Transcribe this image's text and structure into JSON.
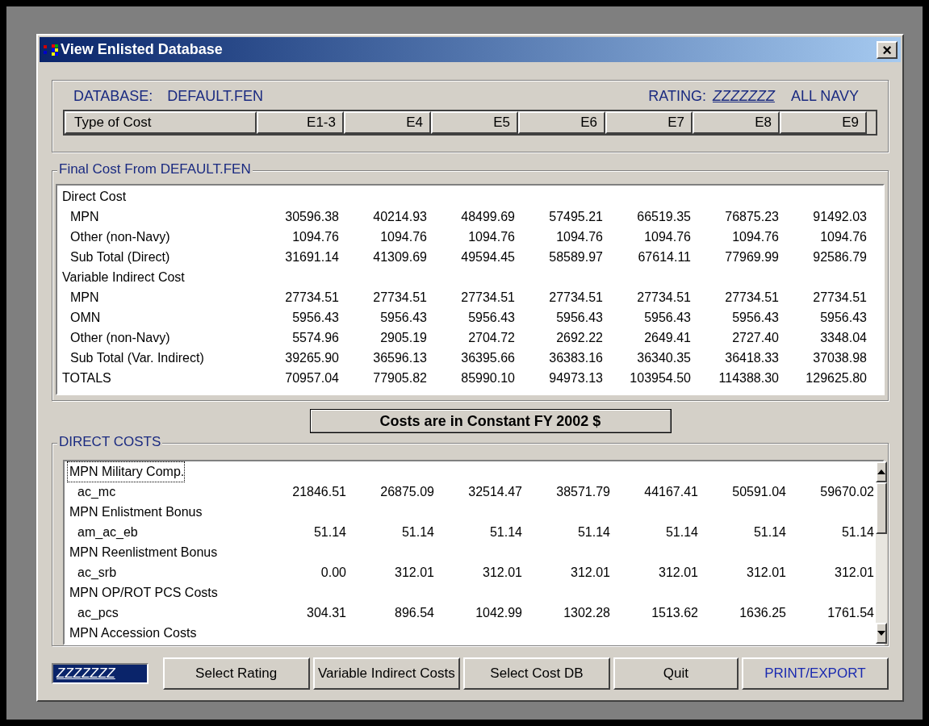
{
  "window": {
    "title": "View Enlisted Database",
    "close": "×"
  },
  "header": {
    "database_label": "DATABASE:",
    "database": "DEFAULT.FEN",
    "rating_label": "RATING:",
    "rating": "ZZZZZZZ",
    "scope": "ALL NAVY",
    "columns": [
      "Type of Cost",
      "E1-3",
      "E4",
      "E5",
      "E6",
      "E7",
      "E8",
      "E9"
    ]
  },
  "final_cost": {
    "title": "Final Cost From DEFAULT.FEN",
    "rows": [
      {
        "kind": "group",
        "label": "Direct Cost",
        "values": []
      },
      {
        "kind": "item",
        "label": "MPN",
        "values": [
          "30596.38",
          "40214.93",
          "48499.69",
          "57495.21",
          "66519.35",
          "76875.23",
          "91492.03"
        ]
      },
      {
        "kind": "item",
        "label": "Other (non-Navy)",
        "values": [
          "1094.76",
          "1094.76",
          "1094.76",
          "1094.76",
          "1094.76",
          "1094.76",
          "1094.76"
        ]
      },
      {
        "kind": "item",
        "label": "Sub Total (Direct)",
        "values": [
          "31691.14",
          "41309.69",
          "49594.45",
          "58589.97",
          "67614.11",
          "77969.99",
          "92586.79"
        ]
      },
      {
        "kind": "group",
        "label": "Variable Indirect Cost",
        "values": []
      },
      {
        "kind": "item",
        "label": "MPN",
        "values": [
          "27734.51",
          "27734.51",
          "27734.51",
          "27734.51",
          "27734.51",
          "27734.51",
          "27734.51"
        ]
      },
      {
        "kind": "item",
        "label": "OMN",
        "values": [
          "5956.43",
          "5956.43",
          "5956.43",
          "5956.43",
          "5956.43",
          "5956.43",
          "5956.43"
        ]
      },
      {
        "kind": "item",
        "label": "Other (non-Navy)",
        "values": [
          "5574.96",
          "2905.19",
          "2704.72",
          "2692.22",
          "2649.41",
          "2727.40",
          "3348.04"
        ]
      },
      {
        "kind": "item",
        "label": "Sub Total (Var. Indirect)",
        "values": [
          "39265.90",
          "36596.13",
          "36395.66",
          "36383.16",
          "36340.35",
          "36418.33",
          "37038.98"
        ]
      },
      {
        "kind": "group",
        "label": "TOTALS",
        "values": [
          "70957.04",
          "77905.82",
          "85990.10",
          "94973.13",
          "103954.50",
          "114388.30",
          "129625.80"
        ]
      }
    ]
  },
  "constant_button": "Costs are in Constant FY 2002 $",
  "direct_costs": {
    "title": "DIRECT COSTS",
    "rows": [
      {
        "kind": "group",
        "label": "MPN Military Comp.",
        "selected": true,
        "values": []
      },
      {
        "kind": "item",
        "label": "ac_mc",
        "selected": false,
        "values": [
          "21846.51",
          "26875.09",
          "32514.47",
          "38571.79",
          "44167.41",
          "50591.04",
          "59670.02"
        ]
      },
      {
        "kind": "group",
        "label": "MPN Enlistment Bonus",
        "selected": false,
        "values": []
      },
      {
        "kind": "item",
        "label": "am_ac_eb",
        "selected": false,
        "values": [
          "51.14",
          "51.14",
          "51.14",
          "51.14",
          "51.14",
          "51.14",
          "51.14"
        ]
      },
      {
        "kind": "group",
        "label": "MPN Reenlistment Bonus",
        "selected": false,
        "values": []
      },
      {
        "kind": "item",
        "label": "ac_srb",
        "selected": false,
        "values": [
          "0.00",
          "312.01",
          "312.01",
          "312.01",
          "312.01",
          "312.01",
          "312.01"
        ]
      },
      {
        "kind": "group",
        "label": "MPN OP/ROT PCS Costs",
        "selected": false,
        "values": []
      },
      {
        "kind": "item",
        "label": "ac_pcs",
        "selected": false,
        "values": [
          "304.31",
          "896.54",
          "1042.99",
          "1302.28",
          "1513.62",
          "1636.25",
          "1761.54"
        ]
      },
      {
        "kind": "group",
        "label": "MPN Accession Costs",
        "selected": false,
        "values": []
      }
    ]
  },
  "status": "ZZZZZZZ",
  "buttons": [
    {
      "label": "Select Rating",
      "kind": "normal"
    },
    {
      "label": "Variable Indirect Costs",
      "kind": "normal"
    },
    {
      "label": "Select Cost DB",
      "kind": "normal"
    },
    {
      "label": "Quit",
      "kind": "normal"
    },
    {
      "label": "PRINT/EXPORT",
      "kind": "accent"
    }
  ]
}
